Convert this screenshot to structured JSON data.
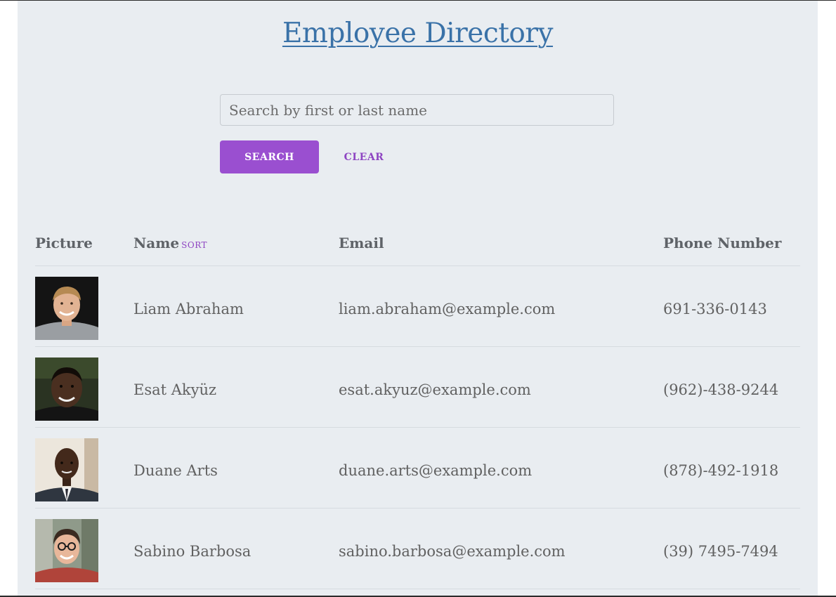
{
  "header": {
    "title": "Employee Directory"
  },
  "search": {
    "placeholder": "Search by first or last name",
    "value": "",
    "search_label": "SEARCH",
    "clear_label": "CLEAR"
  },
  "table": {
    "columns": {
      "picture": "Picture",
      "name": "Name",
      "name_sort": "SORT",
      "email": "Email",
      "phone": "Phone Number"
    },
    "rows": [
      {
        "name": "Liam Abraham",
        "email": "liam.abraham@example.com",
        "phone": "691-336-0143"
      },
      {
        "name": "Esat Akyüz",
        "email": "esat.akyuz@example.com",
        "phone": "(962)-438-9244"
      },
      {
        "name": "Duane Arts",
        "email": "duane.arts@example.com",
        "phone": "(878)-492-1918"
      },
      {
        "name": "Sabino Barbosa",
        "email": "sabino.barbosa@example.com",
        "phone": "(39) 7495-7494"
      }
    ]
  },
  "colors": {
    "background": "#e9edf1",
    "title": "#3a72a8",
    "accent": "#9a4fd0",
    "text": "#616161"
  }
}
